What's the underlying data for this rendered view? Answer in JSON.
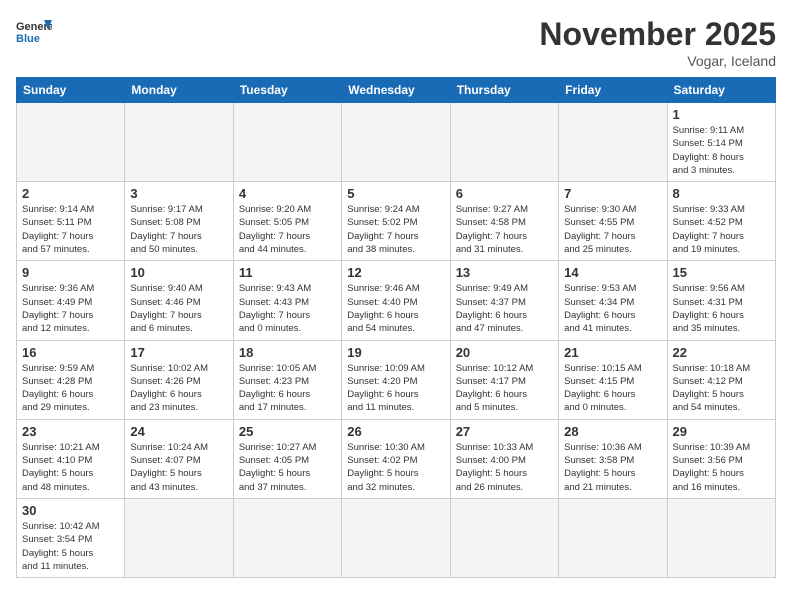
{
  "header": {
    "logo_general": "General",
    "logo_blue": "Blue",
    "month_title": "November 2025",
    "subtitle": "Vogar, Iceland"
  },
  "weekdays": [
    "Sunday",
    "Monday",
    "Tuesday",
    "Wednesday",
    "Thursday",
    "Friday",
    "Saturday"
  ],
  "weeks": [
    [
      {
        "day": "",
        "info": ""
      },
      {
        "day": "",
        "info": ""
      },
      {
        "day": "",
        "info": ""
      },
      {
        "day": "",
        "info": ""
      },
      {
        "day": "",
        "info": ""
      },
      {
        "day": "",
        "info": ""
      },
      {
        "day": "1",
        "info": "Sunrise: 9:11 AM\nSunset: 5:14 PM\nDaylight: 8 hours\nand 3 minutes."
      }
    ],
    [
      {
        "day": "2",
        "info": "Sunrise: 9:14 AM\nSunset: 5:11 PM\nDaylight: 7 hours\nand 57 minutes."
      },
      {
        "day": "3",
        "info": "Sunrise: 9:17 AM\nSunset: 5:08 PM\nDaylight: 7 hours\nand 50 minutes."
      },
      {
        "day": "4",
        "info": "Sunrise: 9:20 AM\nSunset: 5:05 PM\nDaylight: 7 hours\nand 44 minutes."
      },
      {
        "day": "5",
        "info": "Sunrise: 9:24 AM\nSunset: 5:02 PM\nDaylight: 7 hours\nand 38 minutes."
      },
      {
        "day": "6",
        "info": "Sunrise: 9:27 AM\nSunset: 4:58 PM\nDaylight: 7 hours\nand 31 minutes."
      },
      {
        "day": "7",
        "info": "Sunrise: 9:30 AM\nSunset: 4:55 PM\nDaylight: 7 hours\nand 25 minutes."
      },
      {
        "day": "8",
        "info": "Sunrise: 9:33 AM\nSunset: 4:52 PM\nDaylight: 7 hours\nand 19 minutes."
      }
    ],
    [
      {
        "day": "9",
        "info": "Sunrise: 9:36 AM\nSunset: 4:49 PM\nDaylight: 7 hours\nand 12 minutes."
      },
      {
        "day": "10",
        "info": "Sunrise: 9:40 AM\nSunset: 4:46 PM\nDaylight: 7 hours\nand 6 minutes."
      },
      {
        "day": "11",
        "info": "Sunrise: 9:43 AM\nSunset: 4:43 PM\nDaylight: 7 hours\nand 0 minutes."
      },
      {
        "day": "12",
        "info": "Sunrise: 9:46 AM\nSunset: 4:40 PM\nDaylight: 6 hours\nand 54 minutes."
      },
      {
        "day": "13",
        "info": "Sunrise: 9:49 AM\nSunset: 4:37 PM\nDaylight: 6 hours\nand 47 minutes."
      },
      {
        "day": "14",
        "info": "Sunrise: 9:53 AM\nSunset: 4:34 PM\nDaylight: 6 hours\nand 41 minutes."
      },
      {
        "day": "15",
        "info": "Sunrise: 9:56 AM\nSunset: 4:31 PM\nDaylight: 6 hours\nand 35 minutes."
      }
    ],
    [
      {
        "day": "16",
        "info": "Sunrise: 9:59 AM\nSunset: 4:28 PM\nDaylight: 6 hours\nand 29 minutes."
      },
      {
        "day": "17",
        "info": "Sunrise: 10:02 AM\nSunset: 4:26 PM\nDaylight: 6 hours\nand 23 minutes."
      },
      {
        "day": "18",
        "info": "Sunrise: 10:05 AM\nSunset: 4:23 PM\nDaylight: 6 hours\nand 17 minutes."
      },
      {
        "day": "19",
        "info": "Sunrise: 10:09 AM\nSunset: 4:20 PM\nDaylight: 6 hours\nand 11 minutes."
      },
      {
        "day": "20",
        "info": "Sunrise: 10:12 AM\nSunset: 4:17 PM\nDaylight: 6 hours\nand 5 minutes."
      },
      {
        "day": "21",
        "info": "Sunrise: 10:15 AM\nSunset: 4:15 PM\nDaylight: 6 hours\nand 0 minutes."
      },
      {
        "day": "22",
        "info": "Sunrise: 10:18 AM\nSunset: 4:12 PM\nDaylight: 5 hours\nand 54 minutes."
      }
    ],
    [
      {
        "day": "23",
        "info": "Sunrise: 10:21 AM\nSunset: 4:10 PM\nDaylight: 5 hours\nand 48 minutes."
      },
      {
        "day": "24",
        "info": "Sunrise: 10:24 AM\nSunset: 4:07 PM\nDaylight: 5 hours\nand 43 minutes."
      },
      {
        "day": "25",
        "info": "Sunrise: 10:27 AM\nSunset: 4:05 PM\nDaylight: 5 hours\nand 37 minutes."
      },
      {
        "day": "26",
        "info": "Sunrise: 10:30 AM\nSunset: 4:02 PM\nDaylight: 5 hours\nand 32 minutes."
      },
      {
        "day": "27",
        "info": "Sunrise: 10:33 AM\nSunset: 4:00 PM\nDaylight: 5 hours\nand 26 minutes."
      },
      {
        "day": "28",
        "info": "Sunrise: 10:36 AM\nSunset: 3:58 PM\nDaylight: 5 hours\nand 21 minutes."
      },
      {
        "day": "29",
        "info": "Sunrise: 10:39 AM\nSunset: 3:56 PM\nDaylight: 5 hours\nand 16 minutes."
      }
    ],
    [
      {
        "day": "30",
        "info": "Sunrise: 10:42 AM\nSunset: 3:54 PM\nDaylight: 5 hours\nand 11 minutes."
      },
      {
        "day": "",
        "info": ""
      },
      {
        "day": "",
        "info": ""
      },
      {
        "day": "",
        "info": ""
      },
      {
        "day": "",
        "info": ""
      },
      {
        "day": "",
        "info": ""
      },
      {
        "day": "",
        "info": ""
      }
    ]
  ]
}
